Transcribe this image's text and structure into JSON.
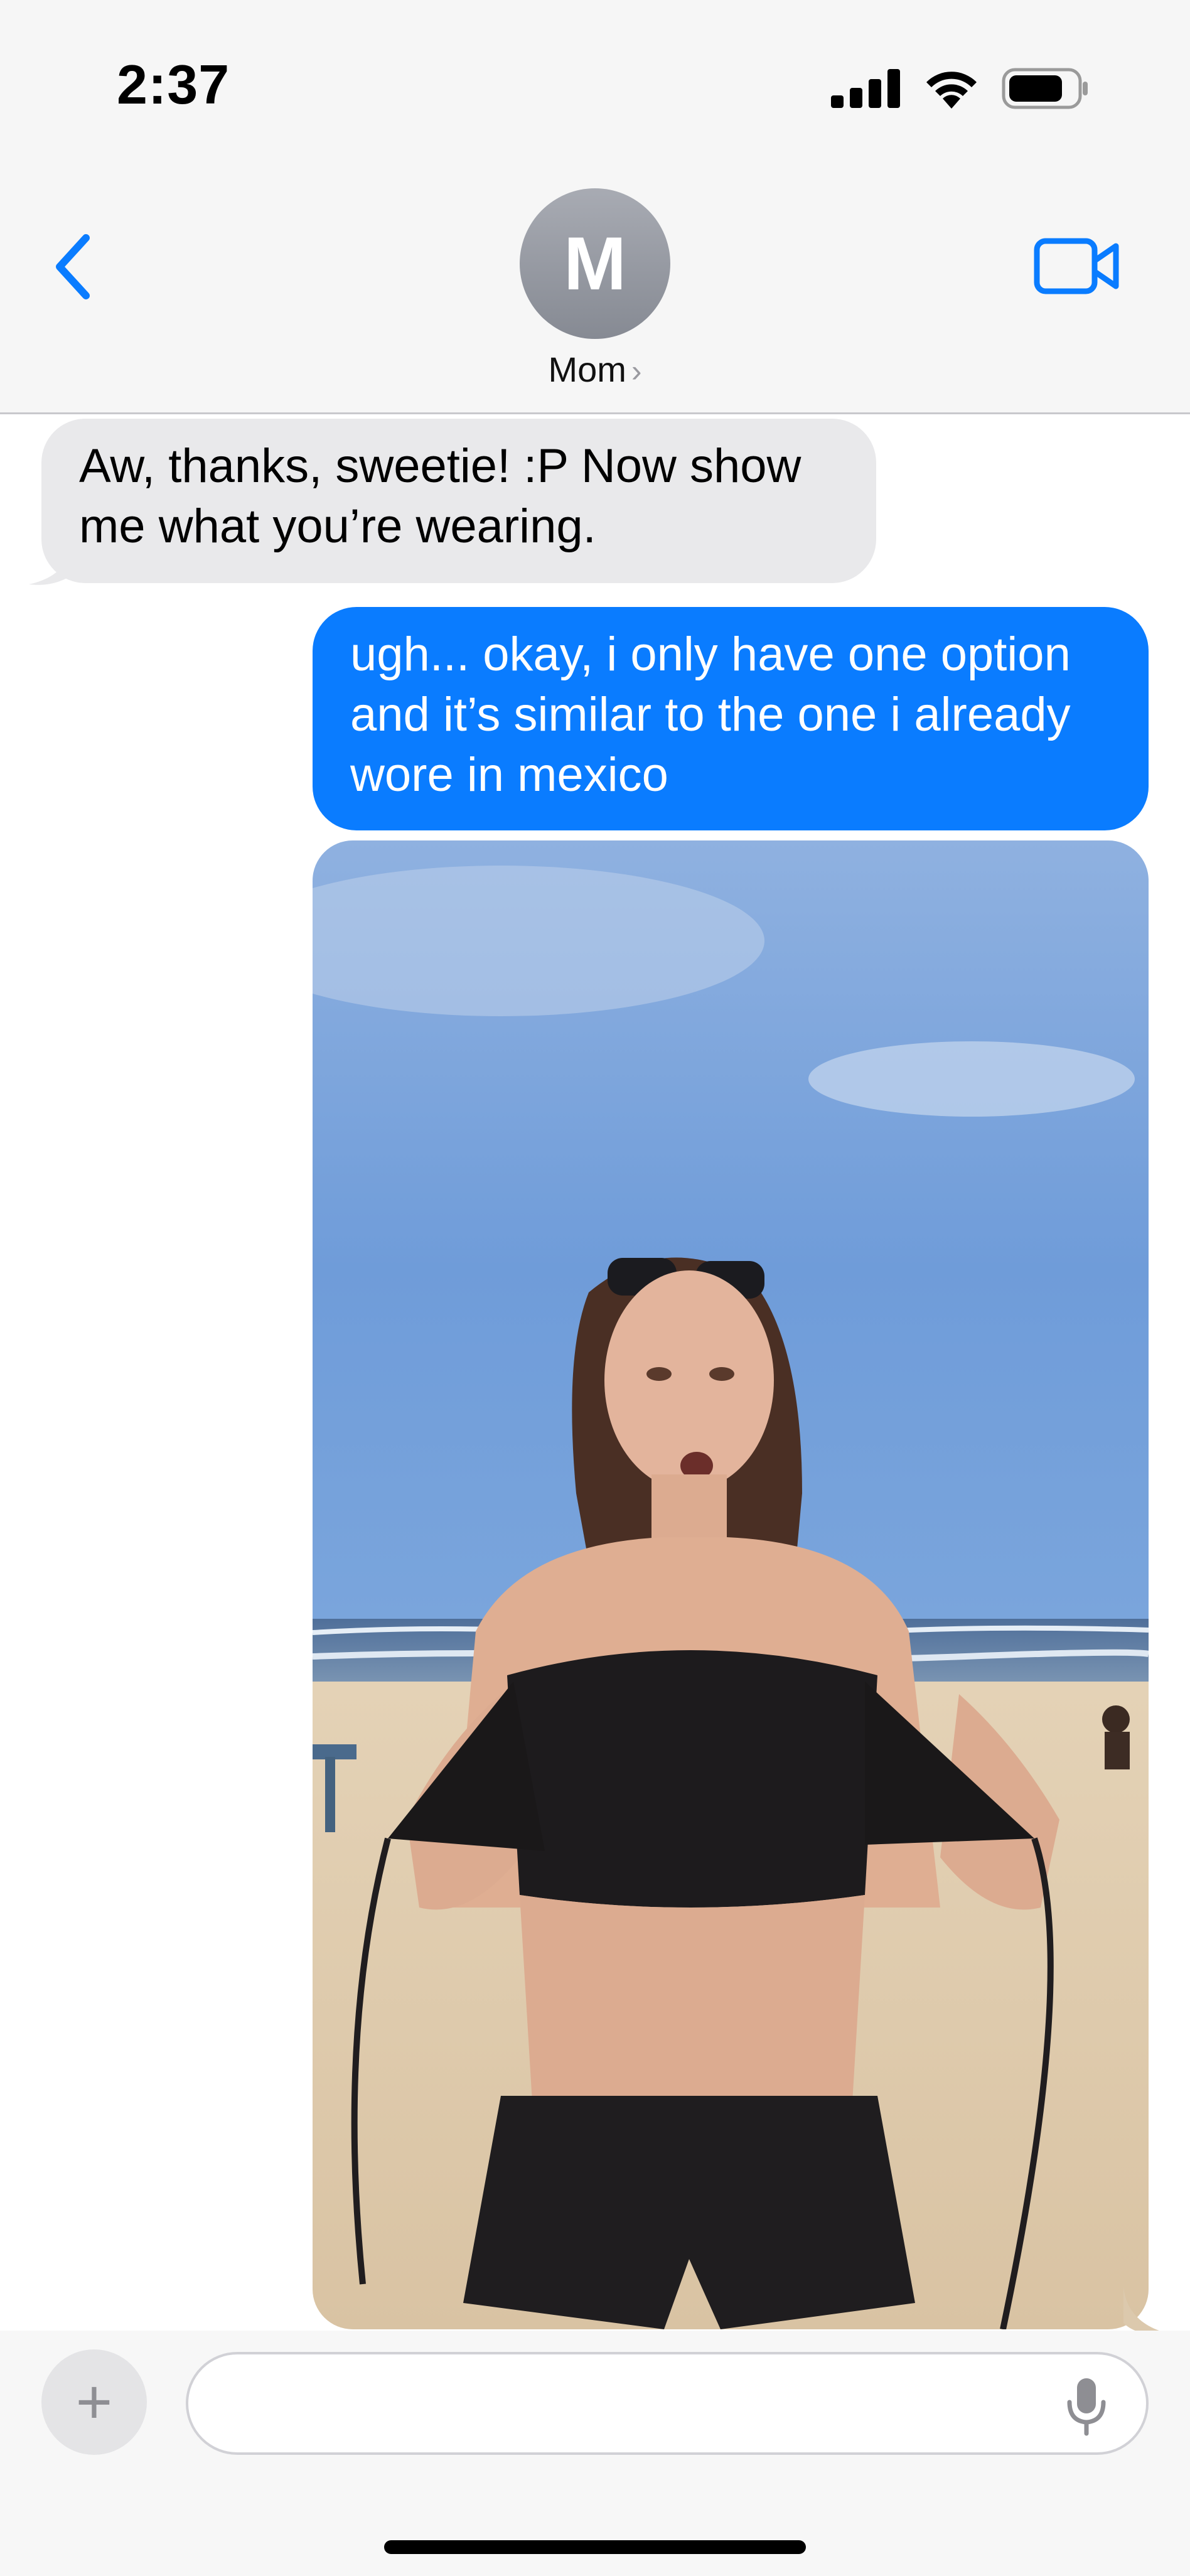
{
  "status_bar": {
    "time": "2:37",
    "icons": [
      "cellular-signal-icon",
      "wifi-icon",
      "battery-icon"
    ]
  },
  "header": {
    "back_icon": "chevron-left-icon",
    "avatar_initial": "M",
    "contact_name": "Mom",
    "contact_chevron": "›",
    "video_icon": "video-camera-icon"
  },
  "messages": [
    {
      "direction": "incoming",
      "text": "Aw, thanks, sweetie! :P Now show me what you’re wearing."
    },
    {
      "direction": "outgoing",
      "text": "ugh... okay, i only have one option and it’s similar to the one i already wore in mexico"
    },
    {
      "direction": "outgoing",
      "type": "photo",
      "photo_alt": "beach-photo"
    }
  ],
  "input_bar": {
    "plus_label": "+",
    "message_value": "",
    "message_placeholder": "",
    "mic_icon": "microphone-icon"
  },
  "colors": {
    "outgoing_bubble": "#0a7cff",
    "incoming_bubble": "#e9e9eb",
    "accent": "#0a7cff",
    "header_background": "#f6f6f6"
  }
}
